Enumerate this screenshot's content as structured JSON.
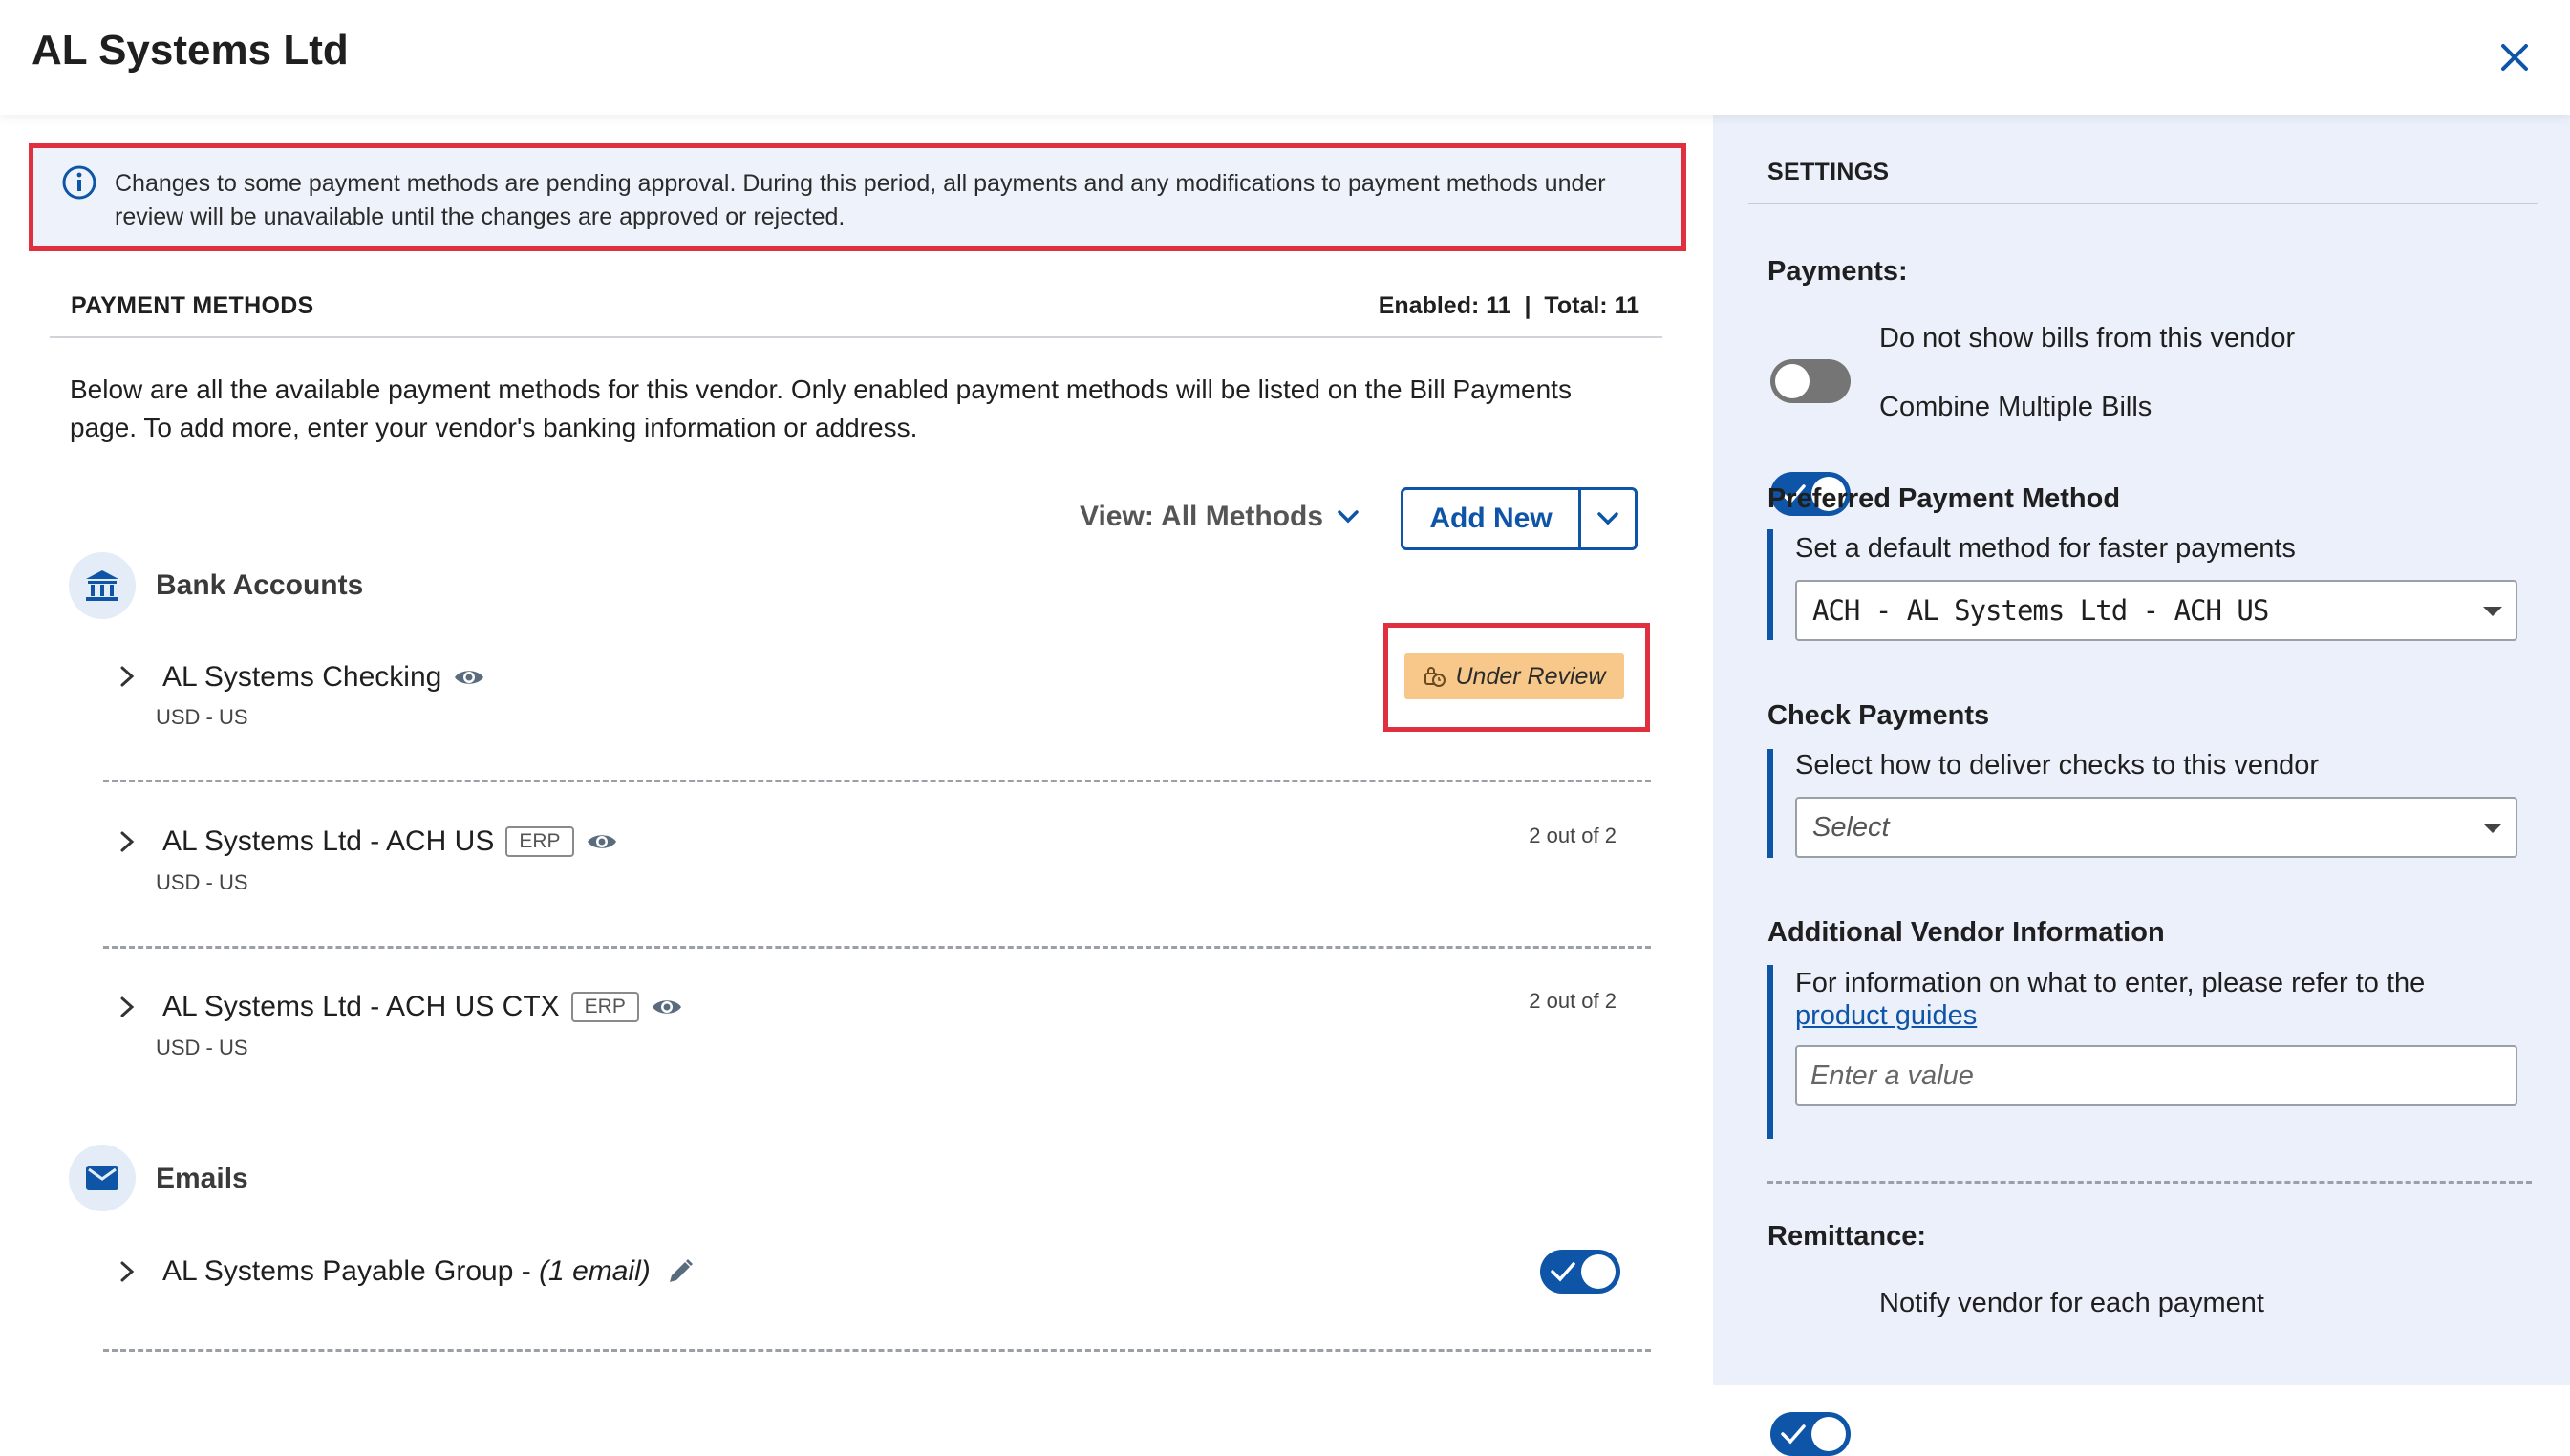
{
  "header": {
    "title": "AL Systems Ltd",
    "close_icon": "close-icon"
  },
  "notice": {
    "text": "Changes to some payment methods are pending approval. During this period, all payments and any modifications to payment methods under review will be unavailable until the changes are approved or rejected.",
    "icon": "info-icon"
  },
  "payment_methods": {
    "title": "PAYMENT METHODS",
    "counts": "Enabled: 11  |  Total: 11",
    "description": "Below are all the available payment methods for this vendor. Only enabled payment methods will be listed on the Bill Payments page. To add more, enter your vendor's banking information or address.",
    "view_label": "View: All Methods",
    "add_new_label": "Add New",
    "groups": {
      "bank": {
        "label": "Bank Accounts",
        "rows": [
          {
            "name": "AL Systems Checking",
            "sub": "USD - US",
            "status": "Under Review"
          },
          {
            "name": "AL Systems Ltd - ACH US",
            "tag": "ERP",
            "sub": "USD - US",
            "count": "2 out of 2"
          },
          {
            "name": "AL Systems Ltd - ACH US CTX",
            "tag": "ERP",
            "sub": "USD - US",
            "count": "2 out of 2"
          }
        ]
      },
      "emails": {
        "label": "Emails",
        "rows": [
          {
            "name": "AL Systems Payable Group - ",
            "name_em": "(1 email)",
            "enabled": true
          }
        ]
      }
    }
  },
  "settings": {
    "title": "SETTINGS",
    "payments": {
      "heading": "Payments:",
      "do_not_show": {
        "label": "Do not show bills from this vendor",
        "enabled": false
      },
      "combine": {
        "label": "Combine Multiple Bills",
        "enabled": true
      }
    },
    "preferred": {
      "heading": "Preferred Payment Method",
      "text": "Set a default method for faster payments",
      "value": "ACH - AL Systems Ltd - ACH US"
    },
    "check": {
      "heading": "Check Payments",
      "text": "Select how to deliver checks to this vendor",
      "placeholder": "Select"
    },
    "additional": {
      "heading": "Additional Vendor Information",
      "text": "For information on what to enter, please refer to the",
      "link": "product guides",
      "placeholder": "Enter a value"
    },
    "remittance": {
      "heading": "Remittance:",
      "notify": {
        "label": "Notify vendor for each payment",
        "enabled": true
      }
    }
  },
  "colors": {
    "accent": "#0e55a8",
    "alert": "#e03040",
    "review_badge": "#f7c88a",
    "panel": "#ebf0fa"
  }
}
